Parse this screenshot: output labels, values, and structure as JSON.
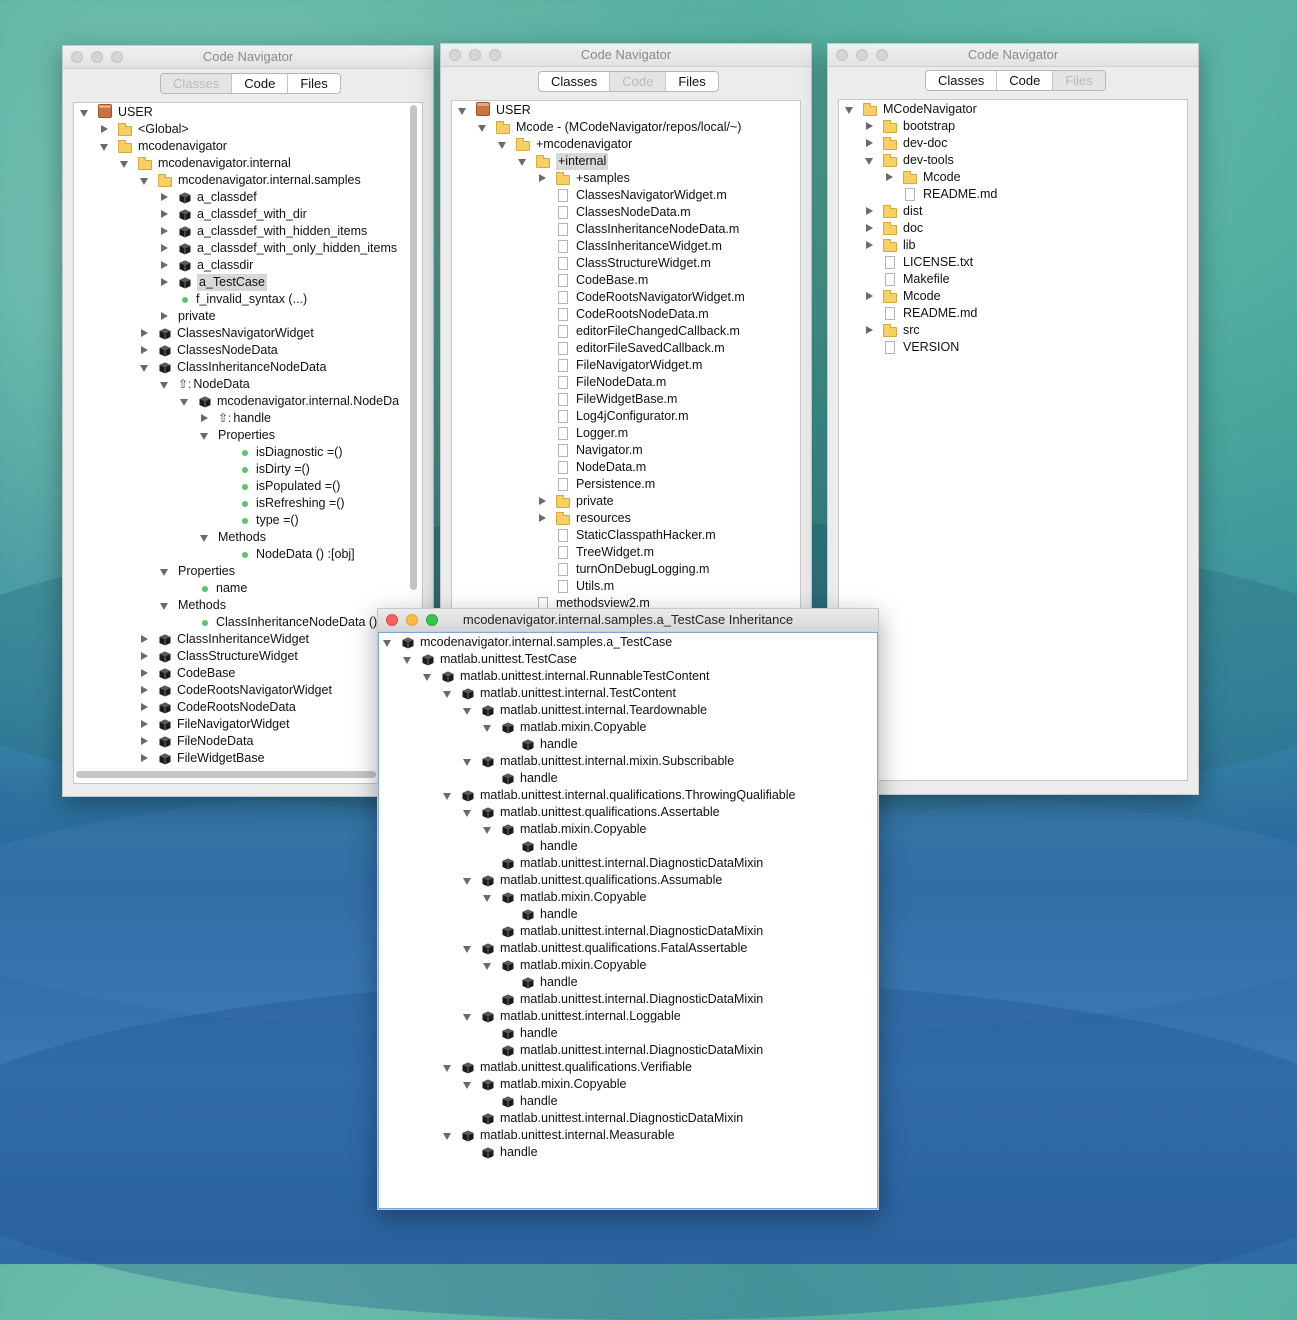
{
  "windows": {
    "w1": {
      "title": "Code Navigator",
      "tabs": [
        "Classes",
        "Code",
        "Files"
      ],
      "selected": 0
    },
    "w2": {
      "title": "Code Navigator",
      "tabs": [
        "Classes",
        "Code",
        "Files"
      ],
      "selected": 1
    },
    "w3": {
      "title": "Code Navigator",
      "tabs": [
        "Classes",
        "Code",
        "Files"
      ],
      "selected": 2
    },
    "w4": {
      "title": "mcodenavigator.internal.samples.a_TestCase Inheritance"
    }
  },
  "tree1": [
    {
      "d": 0,
      "t": "e",
      "i": "user",
      "l": "USER"
    },
    {
      "d": 1,
      "t": "c",
      "i": "folder",
      "l": "<Global>"
    },
    {
      "d": 1,
      "t": "e",
      "i": "folder",
      "l": "mcodenavigator"
    },
    {
      "d": 2,
      "t": "e",
      "i": "folder",
      "l": "mcodenavigator.internal"
    },
    {
      "d": 3,
      "t": "e",
      "i": "folder",
      "l": "mcodenavigator.internal.samples"
    },
    {
      "d": 4,
      "t": "c",
      "i": "cls",
      "l": "a_classdef"
    },
    {
      "d": 4,
      "t": "c",
      "i": "cls",
      "l": "a_classdef_with_dir"
    },
    {
      "d": 4,
      "t": "c",
      "i": "cls",
      "l": "a_classdef_with_hidden_items"
    },
    {
      "d": 4,
      "t": "c",
      "i": "cls",
      "l": "a_classdef_with_only_hidden_items"
    },
    {
      "d": 4,
      "t": "c",
      "i": "cls",
      "l": "a_classdir"
    },
    {
      "d": 4,
      "t": "c",
      "i": "cls",
      "l": "a_TestCase",
      "hl": true
    },
    {
      "d": 4,
      "t": "n",
      "i": "dot",
      "l": "f_invalid_syntax (...)"
    },
    {
      "d": 4,
      "t": "c",
      "i": "none",
      "l": "private"
    },
    {
      "d": 3,
      "t": "c",
      "i": "cls",
      "l": "ClassesNavigatorWidget"
    },
    {
      "d": 3,
      "t": "c",
      "i": "cls",
      "l": "ClassesNodeData"
    },
    {
      "d": 3,
      "t": "e",
      "i": "cls",
      "l": "ClassInheritanceNodeData"
    },
    {
      "d": 4,
      "t": "e",
      "i": "up",
      "l": "NodeData"
    },
    {
      "d": 5,
      "t": "e",
      "i": "cls",
      "l": "mcodenavigator.internal.NodeDa"
    },
    {
      "d": 6,
      "t": "c",
      "i": "up",
      "l": "handle"
    },
    {
      "d": 6,
      "t": "e",
      "i": "none",
      "l": "Properties"
    },
    {
      "d": 7,
      "t": "n",
      "i": "dot",
      "l": "isDiagnostic =()"
    },
    {
      "d": 7,
      "t": "n",
      "i": "dot",
      "l": "isDirty =()"
    },
    {
      "d": 7,
      "t": "n",
      "i": "dot",
      "l": "isPopulated =()"
    },
    {
      "d": 7,
      "t": "n",
      "i": "dot",
      "l": "isRefreshing =()"
    },
    {
      "d": 7,
      "t": "n",
      "i": "dot",
      "l": "type =()"
    },
    {
      "d": 6,
      "t": "e",
      "i": "none",
      "l": "Methods"
    },
    {
      "d": 7,
      "t": "n",
      "i": "dot",
      "l": "NodeData () :[obj]"
    },
    {
      "d": 4,
      "t": "e",
      "i": "none",
      "l": "Properties"
    },
    {
      "d": 5,
      "t": "n",
      "i": "dot",
      "l": "name"
    },
    {
      "d": 4,
      "t": "e",
      "i": "none",
      "l": "Methods"
    },
    {
      "d": 5,
      "t": "n",
      "i": "dot",
      "l": "ClassInheritanceNodeData ()"
    },
    {
      "d": 3,
      "t": "c",
      "i": "cls",
      "l": "ClassInheritanceWidget"
    },
    {
      "d": 3,
      "t": "c",
      "i": "cls",
      "l": "ClassStructureWidget"
    },
    {
      "d": 3,
      "t": "c",
      "i": "cls",
      "l": "CodeBase"
    },
    {
      "d": 3,
      "t": "c",
      "i": "cls",
      "l": "CodeRootsNavigatorWidget"
    },
    {
      "d": 3,
      "t": "c",
      "i": "cls",
      "l": "CodeRootsNodeData"
    },
    {
      "d": 3,
      "t": "c",
      "i": "cls",
      "l": "FileNavigatorWidget"
    },
    {
      "d": 3,
      "t": "c",
      "i": "cls",
      "l": "FileNodeData"
    },
    {
      "d": 3,
      "t": "c",
      "i": "cls",
      "l": "FileWidgetBase"
    }
  ],
  "tree2": [
    {
      "d": 0,
      "t": "e",
      "i": "user",
      "l": "USER"
    },
    {
      "d": 1,
      "t": "e",
      "i": "folder",
      "l": "Mcode - (MCodeNavigator/repos/local/~)"
    },
    {
      "d": 2,
      "t": "e",
      "i": "folder",
      "l": "+mcodenavigator"
    },
    {
      "d": 3,
      "t": "e",
      "i": "folder",
      "l": "+internal",
      "hl": true
    },
    {
      "d": 4,
      "t": "c",
      "i": "folder",
      "l": "+samples"
    },
    {
      "d": 4,
      "t": "n",
      "i": "file",
      "l": "ClassesNavigatorWidget.m"
    },
    {
      "d": 4,
      "t": "n",
      "i": "file",
      "l": "ClassesNodeData.m"
    },
    {
      "d": 4,
      "t": "n",
      "i": "file",
      "l": "ClassInheritanceNodeData.m"
    },
    {
      "d": 4,
      "t": "n",
      "i": "file",
      "l": "ClassInheritanceWidget.m"
    },
    {
      "d": 4,
      "t": "n",
      "i": "file",
      "l": "ClassStructureWidget.m"
    },
    {
      "d": 4,
      "t": "n",
      "i": "file",
      "l": "CodeBase.m"
    },
    {
      "d": 4,
      "t": "n",
      "i": "file",
      "l": "CodeRootsNavigatorWidget.m"
    },
    {
      "d": 4,
      "t": "n",
      "i": "file",
      "l": "CodeRootsNodeData.m"
    },
    {
      "d": 4,
      "t": "n",
      "i": "file",
      "l": "editorFileChangedCallback.m"
    },
    {
      "d": 4,
      "t": "n",
      "i": "file",
      "l": "editorFileSavedCallback.m"
    },
    {
      "d": 4,
      "t": "n",
      "i": "file",
      "l": "FileNavigatorWidget.m"
    },
    {
      "d": 4,
      "t": "n",
      "i": "file",
      "l": "FileNodeData.m"
    },
    {
      "d": 4,
      "t": "n",
      "i": "file",
      "l": "FileWidgetBase.m"
    },
    {
      "d": 4,
      "t": "n",
      "i": "file",
      "l": "Log4jConfigurator.m"
    },
    {
      "d": 4,
      "t": "n",
      "i": "file",
      "l": "Logger.m"
    },
    {
      "d": 4,
      "t": "n",
      "i": "file",
      "l": "Navigator.m"
    },
    {
      "d": 4,
      "t": "n",
      "i": "file",
      "l": "NodeData.m"
    },
    {
      "d": 4,
      "t": "n",
      "i": "file",
      "l": "Persistence.m"
    },
    {
      "d": 4,
      "t": "c",
      "i": "folder",
      "l": "private"
    },
    {
      "d": 4,
      "t": "c",
      "i": "folder",
      "l": "resources"
    },
    {
      "d": 4,
      "t": "n",
      "i": "file",
      "l": "StaticClasspathHacker.m"
    },
    {
      "d": 4,
      "t": "n",
      "i": "file",
      "l": "TreeWidget.m"
    },
    {
      "d": 4,
      "t": "n",
      "i": "file",
      "l": "turnOnDebugLogging.m"
    },
    {
      "d": 4,
      "t": "n",
      "i": "file",
      "l": "Utils.m"
    },
    {
      "d": 3,
      "t": "n",
      "i": "file",
      "l": "methodsview2.m"
    }
  ],
  "tree3": [
    {
      "d": 0,
      "t": "e",
      "i": "folder",
      "l": "MCodeNavigator"
    },
    {
      "d": 1,
      "t": "c",
      "i": "folder",
      "l": "bootstrap"
    },
    {
      "d": 1,
      "t": "c",
      "i": "folder",
      "l": "dev-doc"
    },
    {
      "d": 1,
      "t": "e",
      "i": "folder",
      "l": "dev-tools"
    },
    {
      "d": 2,
      "t": "c",
      "i": "folder",
      "l": "Mcode"
    },
    {
      "d": 2,
      "t": "n",
      "i": "file",
      "l": "README.md"
    },
    {
      "d": 1,
      "t": "c",
      "i": "folder",
      "l": "dist"
    },
    {
      "d": 1,
      "t": "c",
      "i": "folder",
      "l": "doc"
    },
    {
      "d": 1,
      "t": "c",
      "i": "folder",
      "l": "lib"
    },
    {
      "d": 1,
      "t": "n",
      "i": "file",
      "l": "LICENSE.txt"
    },
    {
      "d": 1,
      "t": "n",
      "i": "file",
      "l": "Makefile"
    },
    {
      "d": 1,
      "t": "c",
      "i": "folder",
      "l": "Mcode"
    },
    {
      "d": 1,
      "t": "n",
      "i": "file",
      "l": "README.md"
    },
    {
      "d": 1,
      "t": "c",
      "i": "folder",
      "l": "src"
    },
    {
      "d": 1,
      "t": "n",
      "i": "file",
      "l": "VERSION"
    }
  ],
  "tree4": [
    {
      "d": 0,
      "t": "e",
      "i": "cls",
      "l": "mcodenavigator.internal.samples.a_TestCase"
    },
    {
      "d": 1,
      "t": "e",
      "i": "cls",
      "l": "matlab.unittest.TestCase"
    },
    {
      "d": 2,
      "t": "e",
      "i": "cls",
      "l": "matlab.unittest.internal.RunnableTestContent"
    },
    {
      "d": 3,
      "t": "e",
      "i": "cls",
      "l": "matlab.unittest.internal.TestContent"
    },
    {
      "d": 4,
      "t": "e",
      "i": "cls",
      "l": "matlab.unittest.internal.Teardownable"
    },
    {
      "d": 5,
      "t": "e",
      "i": "cls",
      "l": "matlab.mixin.Copyable"
    },
    {
      "d": 6,
      "t": "n",
      "i": "cls",
      "l": "handle"
    },
    {
      "d": 4,
      "t": "e",
      "i": "cls",
      "l": "matlab.unittest.internal.mixin.Subscribable"
    },
    {
      "d": 5,
      "t": "n",
      "i": "cls",
      "l": "handle"
    },
    {
      "d": 3,
      "t": "e",
      "i": "cls",
      "l": "matlab.unittest.internal.qualifications.ThrowingQualifiable"
    },
    {
      "d": 4,
      "t": "e",
      "i": "cls",
      "l": "matlab.unittest.qualifications.Assertable"
    },
    {
      "d": 5,
      "t": "e",
      "i": "cls",
      "l": "matlab.mixin.Copyable"
    },
    {
      "d": 6,
      "t": "n",
      "i": "cls",
      "l": "handle"
    },
    {
      "d": 5,
      "t": "n",
      "i": "cls",
      "l": "matlab.unittest.internal.DiagnosticDataMixin"
    },
    {
      "d": 4,
      "t": "e",
      "i": "cls",
      "l": "matlab.unittest.qualifications.Assumable"
    },
    {
      "d": 5,
      "t": "e",
      "i": "cls",
      "l": "matlab.mixin.Copyable"
    },
    {
      "d": 6,
      "t": "n",
      "i": "cls",
      "l": "handle"
    },
    {
      "d": 5,
      "t": "n",
      "i": "cls",
      "l": "matlab.unittest.internal.DiagnosticDataMixin"
    },
    {
      "d": 4,
      "t": "e",
      "i": "cls",
      "l": "matlab.unittest.qualifications.FatalAssertable"
    },
    {
      "d": 5,
      "t": "e",
      "i": "cls",
      "l": "matlab.mixin.Copyable"
    },
    {
      "d": 6,
      "t": "n",
      "i": "cls",
      "l": "handle"
    },
    {
      "d": 5,
      "t": "n",
      "i": "cls",
      "l": "matlab.unittest.internal.DiagnosticDataMixin"
    },
    {
      "d": 4,
      "t": "e",
      "i": "cls",
      "l": "matlab.unittest.internal.Loggable"
    },
    {
      "d": 5,
      "t": "n",
      "i": "cls",
      "l": "handle"
    },
    {
      "d": 5,
      "t": "n",
      "i": "cls",
      "l": "matlab.unittest.internal.DiagnosticDataMixin"
    },
    {
      "d": 3,
      "t": "e",
      "i": "cls",
      "l": "matlab.unittest.qualifications.Verifiable"
    },
    {
      "d": 4,
      "t": "e",
      "i": "cls",
      "l": "matlab.mixin.Copyable"
    },
    {
      "d": 5,
      "t": "n",
      "i": "cls",
      "l": "handle"
    },
    {
      "d": 4,
      "t": "n",
      "i": "cls",
      "l": "matlab.unittest.internal.DiagnosticDataMixin"
    },
    {
      "d": 3,
      "t": "e",
      "i": "cls",
      "l": "matlab.unittest.internal.Measurable"
    },
    {
      "d": 4,
      "t": "n",
      "i": "cls",
      "l": "handle"
    }
  ]
}
